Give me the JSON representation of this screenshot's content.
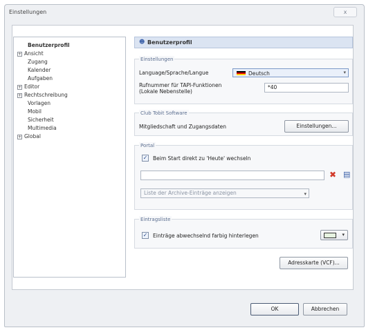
{
  "window": {
    "title": "Einstellungen",
    "close_glyph": "x"
  },
  "tree": {
    "items": [
      {
        "label": "Benutzerprofil",
        "expander": "",
        "bold": true
      },
      {
        "label": "Ansicht",
        "expander": "+"
      },
      {
        "label": "Zugang",
        "expander": ""
      },
      {
        "label": "Kalender",
        "expander": ""
      },
      {
        "label": "Aufgaben",
        "expander": ""
      },
      {
        "label": "Editor",
        "expander": "+"
      },
      {
        "label": "Rechtschreibung",
        "expander": "+"
      },
      {
        "label": "Vorlagen",
        "expander": ""
      },
      {
        "label": "Mobil",
        "expander": ""
      },
      {
        "label": "Sicherheit",
        "expander": ""
      },
      {
        "label": "Multimedia",
        "expander": ""
      },
      {
        "label": "Global",
        "expander": "+"
      }
    ]
  },
  "content": {
    "header_title": "Benutzerprofil",
    "header_icon": "user-icon",
    "einstellungen": {
      "group_label": "Einstellungen",
      "language_label": "Language/Sprache/Langue",
      "language_value": "Deutsch",
      "phone_label_1": "Rufnummer für TAPI-Funktionen",
      "phone_label_2": "(Lokale Nebenstelle)",
      "phone_value": "*40"
    },
    "club": {
      "group_label": "Club Tobit Software",
      "membership_label": "Mitgliedschaft und Zugangsdaten",
      "settings_button": "Einstellungen..."
    },
    "portal": {
      "group_label": "Portal",
      "checkbox_label": "Beim Start direkt zu 'Heute' wechseln",
      "checkbox_checked": true,
      "path_value": "",
      "archive_placeholder": "Liste der Archive-Einträge anzeigen"
    },
    "eintragsliste": {
      "group_label": "Eintragsliste",
      "checkbox_label": "Einträge abwechselnd farbig hinterlegen",
      "checkbox_checked": true,
      "color": "#e6f3e0"
    },
    "vcf_button": "Adresskarte (VCF)..."
  },
  "footer": {
    "ok_label": "OK",
    "cancel_label": "Abbrechen"
  }
}
